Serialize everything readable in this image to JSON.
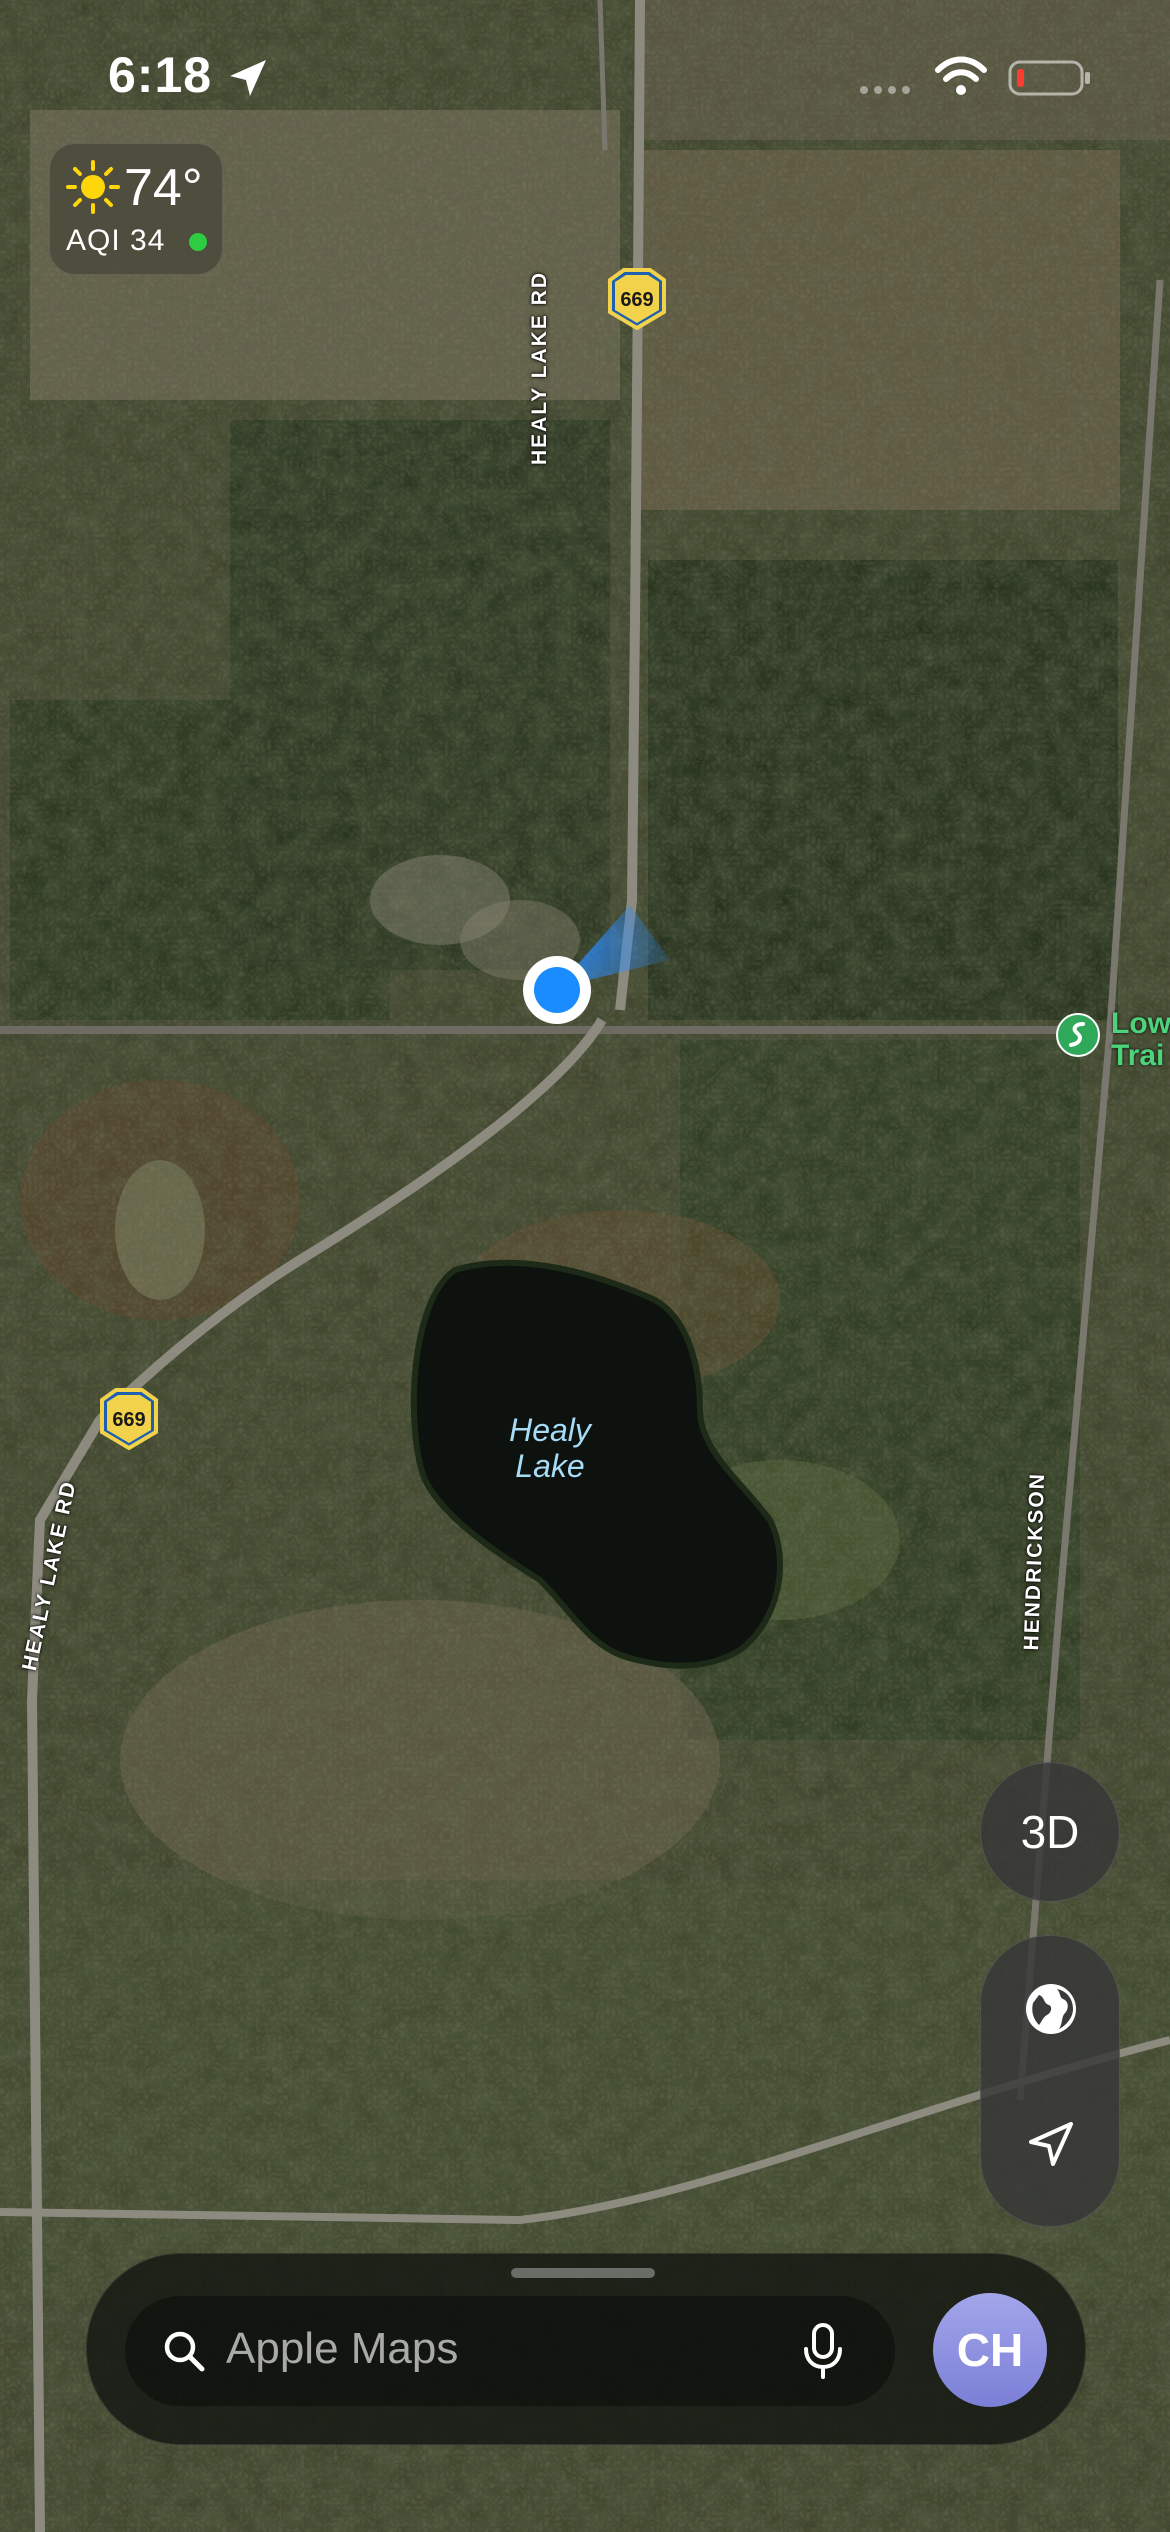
{
  "status_bar": {
    "time": "6:18"
  },
  "weather": {
    "temperature": "74°",
    "aqi": "AQI 34",
    "aqi_color": "#2ecc40"
  },
  "map": {
    "roads": [
      {
        "id": "healy-lake-rd-north",
        "label": "HEALY LAKE RD"
      },
      {
        "id": "healy-lake-rd-south",
        "label": "HEALY LAKE RD"
      },
      {
        "id": "hendrickson",
        "label": "HENDRICKSON"
      }
    ],
    "route_shields": [
      {
        "id": "shield-north",
        "number": "669"
      },
      {
        "id": "shield-south",
        "number": "669"
      }
    ],
    "lake": {
      "line1": "Healy",
      "line2": "Lake"
    },
    "poi": {
      "line1": "Low",
      "line2": "Trai"
    }
  },
  "controls": {
    "three_d_label": "3D"
  },
  "search": {
    "placeholder": "Apple Maps"
  },
  "profile": {
    "initials": "CH"
  },
  "colors": {
    "user_location": "#1a8cff",
    "poi_green": "#4dd37a",
    "lake_label": "#a7dcf6"
  }
}
